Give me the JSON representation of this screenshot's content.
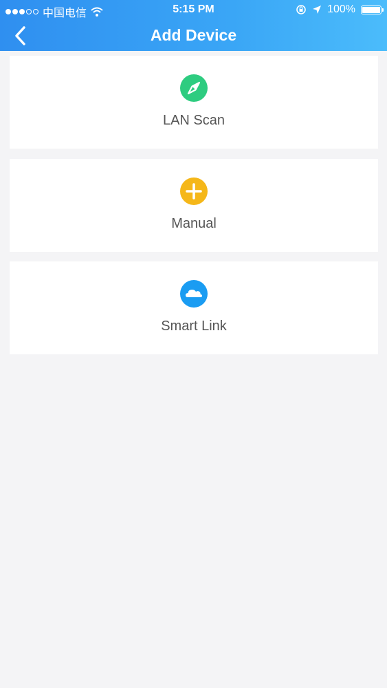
{
  "status_bar": {
    "carrier": "中国电信",
    "time": "5:15 PM",
    "battery": "100%",
    "icons": [
      "signal-dots-icon",
      "wifi-icon",
      "rotation-lock-icon",
      "location-arrow-icon",
      "battery-icon"
    ]
  },
  "header": {
    "title": "Add Device",
    "back_icon": "chevron-left-icon"
  },
  "options": [
    {
      "label": "LAN Scan",
      "icon": "compass-icon",
      "color": "#2ecc80"
    },
    {
      "label": "Manual",
      "icon": "plus-icon",
      "color": "#f5b719"
    },
    {
      "label": "Smart Link",
      "icon": "cloud-icon",
      "color": "#1a9cf2"
    }
  ],
  "colors": {
    "header_start": "#2f8ff0",
    "header_end": "#4bbcfb",
    "background": "#f4f4f6",
    "card": "#ffffff",
    "label_text": "#555555"
  }
}
